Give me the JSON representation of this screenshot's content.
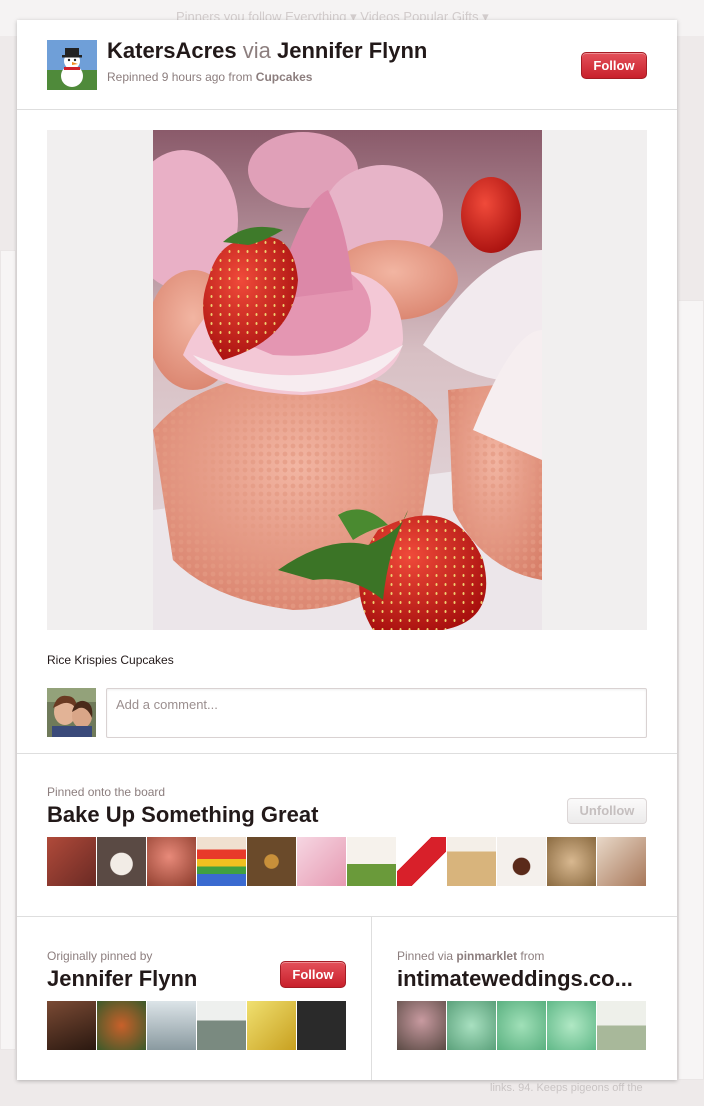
{
  "background": {
    "nav_text": "Pinners you follow   Everything ▾   Videos   Popular   Gifts ▾",
    "footer_snippet": "links. 94. Keeps pigeons off the"
  },
  "pin": {
    "pinner_name": "KatersAcres",
    "via_word": "via",
    "via_name": "Jennifer Flynn",
    "repin_prefix": "Repinned 9 hours ago from",
    "repin_board": "Cupcakes",
    "follow_label": "Follow",
    "description": "Rice Krispies Cupcakes",
    "comment_placeholder": "Add a comment..."
  },
  "board": {
    "label": "Pinned onto the board",
    "title": "Bake Up Something Great",
    "unfollow_label": "Unfollow",
    "thumb_colors": [
      "#8a3b34",
      "#5a4a44",
      "#a85a4a",
      "#d94d3a",
      "#8a6a3a",
      "#e6b7c4",
      "#c9a98a",
      "#d8202a",
      "#e8d6b4",
      "#f3efea",
      "#b89a70",
      "#c8a08a"
    ]
  },
  "original": {
    "label": "Originally pinned by",
    "name": "Jennifer Flynn",
    "follow_label": "Follow",
    "thumb_colors": [
      "#4a3028",
      "#6a5a3a",
      "#c0c8cc",
      "#9aa8a0",
      "#d8c050",
      "#2a2a2a"
    ]
  },
  "pinned_via": {
    "label_prefix": "Pinned via",
    "tool": "pinmarklet",
    "label_suffix": "from",
    "site": "intimateweddings.co...",
    "thumb_colors": [
      "#a89a90",
      "#8fc8a8",
      "#7fc89a",
      "#90d0a8",
      "#b8c8b0"
    ]
  },
  "colors": {
    "accent_red": "#cb2027",
    "heading": "#221919",
    "muted": "#8c7e7e"
  }
}
